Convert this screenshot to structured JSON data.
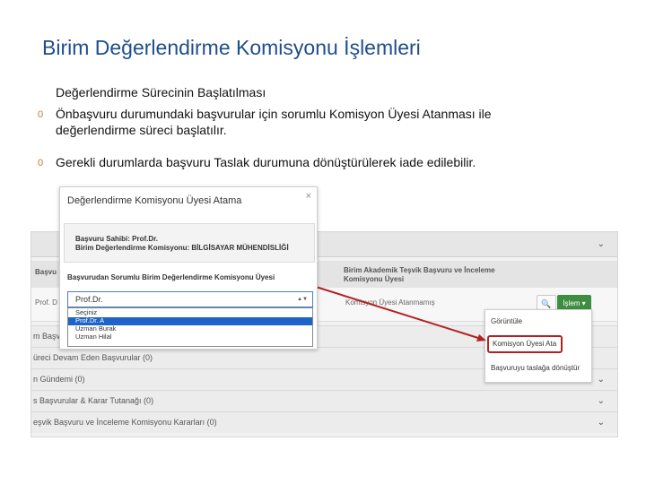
{
  "slide": {
    "title": "Birim Değerlendirme Komisyonu İşlemleri",
    "subhead": "Değerlendirme Sürecinin Başlatılması",
    "bullets": [
      {
        "num": "0",
        "text": "Önbaşvuru durumundaki başvurular için sorumlu Komisyon Üyesi Atanması ile değerlendirme süreci başlatılır."
      },
      {
        "num": "0",
        "text": "Gerekli durumlarda başvuru Taslak durumuna dönüştürülerek iade edilebilir."
      }
    ]
  },
  "modal": {
    "title": "Değerlendirme Komisyonu Üyesi Atama",
    "close": "×",
    "info_line1": "Başvuru Sahibi: Prof.Dr.",
    "info_line2": "Birim Değerlendirme Komisyonu: BİLGİSAYAR MÜHENDİSLİĞİ",
    "field_label": "Başvurudan Sorumlu Birim Değerlendirme Komisyonu Üyesi",
    "select_value": "Prof.Dr.",
    "options": [
      "Seçiniz",
      "Prof.Dr. A",
      "Uzman Burak",
      "Uzman Hilal"
    ]
  },
  "app": {
    "table_header_left": "Başvu",
    "table_header_right": "Birim Akademik Teşvik Başvuru ve İnceleme Komisyonu Üyesi",
    "row_left": "Prof. D",
    "row_status": "Komisyon Üyesi Atanmamış",
    "islem_label": "İşlem ▾",
    "accordions": [
      "m Başvu",
      "üreci Devam Eden Başvurular (0)",
      "n Gündemi (0)",
      "s Başvurular & Karar Tutanağı (0)",
      "eşvik Başvuru ve İnceleme Komisyonu Kararları (0)"
    ],
    "dropdown": {
      "item1": "Görüntüle",
      "item2": "Komisyon Üyesi Ata",
      "item3": "Başvuruyu taslağa dönüştür"
    }
  },
  "colors": {
    "title": "#1f4e8c",
    "bullet_num": "#c27b2e",
    "islem_button": "#3e8e41",
    "highlight": "#b22222",
    "selected_option": "#1e64c8"
  }
}
